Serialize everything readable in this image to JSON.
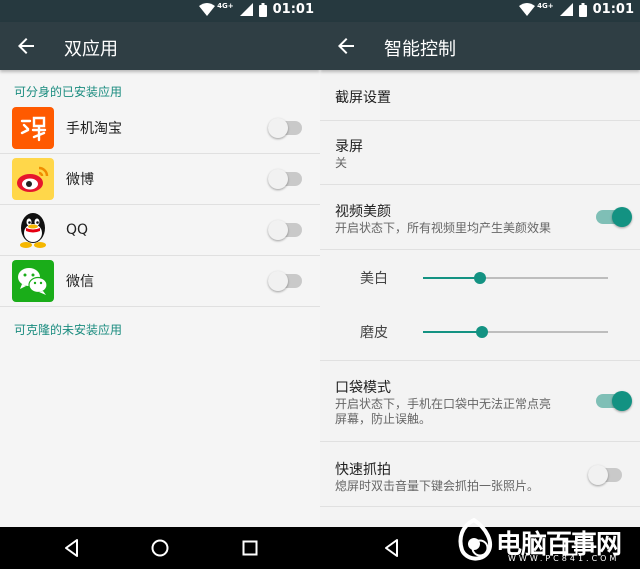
{
  "status_bar": {
    "network": "4G+",
    "time": "01:01"
  },
  "left_screen": {
    "title": "双应用",
    "installed_header": "可分身的已安装应用",
    "apps": [
      {
        "label": "手机淘宝",
        "icon": "taobao-icon",
        "enabled": false
      },
      {
        "label": "微博",
        "icon": "weibo-icon",
        "enabled": false
      },
      {
        "label": "QQ",
        "icon": "qq-icon",
        "enabled": false
      },
      {
        "label": "微信",
        "icon": "wechat-icon",
        "enabled": false
      }
    ],
    "uninstalled_header": "可克隆的未安装应用"
  },
  "right_screen": {
    "title": "智能控制",
    "screenshot_settings": {
      "title": "截屏设置"
    },
    "screen_record": {
      "title": "录屏",
      "summary": "关"
    },
    "video_beauty": {
      "title": "视频美颜",
      "summary": "开启状态下，所有视频里均产生美颜效果",
      "enabled": true
    },
    "whitening": {
      "label": "美白",
      "level": 0.31
    },
    "smoothing": {
      "label": "磨皮",
      "level": 0.32
    },
    "pocket_mode": {
      "title": "口袋模式",
      "summary_line1": "开启状态下，手机在口袋中无法正常点亮",
      "summary_line2": "屏幕，防止误触。",
      "enabled": true
    },
    "quick_snap": {
      "title": "快速抓拍",
      "summary": "熄屏时双击音量下键会抓拍一张照片。",
      "enabled": false
    }
  },
  "watermark": {
    "text": "电脑百事网",
    "url": "WWW.PC841.COM"
  },
  "colors": {
    "accent": "#139282",
    "appbar": "#2f3e44",
    "statusbar": "#26393f"
  }
}
